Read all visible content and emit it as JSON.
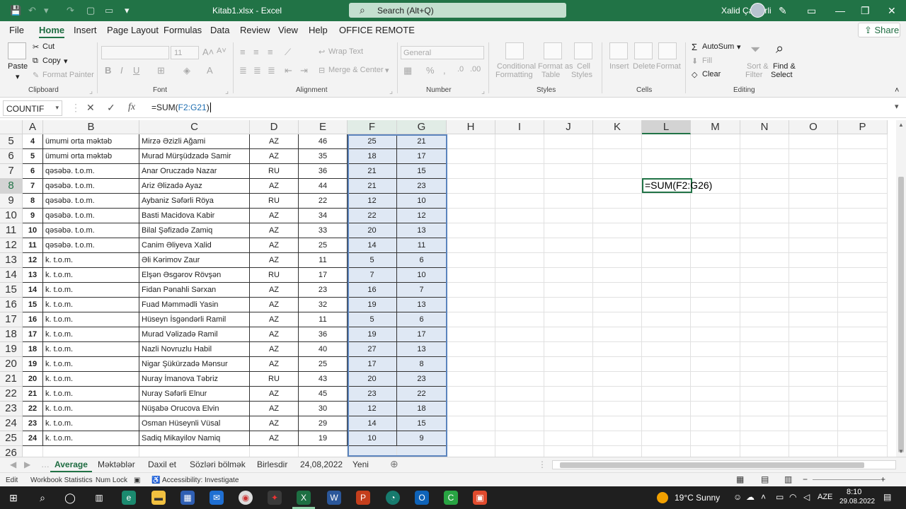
{
  "app": {
    "title": "Kitab1.xlsx  -  Excel",
    "search_label": "Search (Alt+Q)",
    "user_name": "Xalid Çandirli",
    "share_label": "Share"
  },
  "menu": {
    "tabs": [
      "File",
      "Home",
      "Insert",
      "Page Layout",
      "Formulas",
      "Data",
      "Review",
      "View",
      "Help",
      "OFFICE REMOTE"
    ],
    "active": "Home"
  },
  "ribbon": {
    "clipboard": {
      "paste": "Paste",
      "cut": "Cut",
      "copy": "Copy",
      "format_painter": "Format Painter",
      "group": "Clipboard"
    },
    "font": {
      "group": "Font",
      "size": "11"
    },
    "alignment": {
      "wrap_text": "Wrap Text",
      "merge_center": "Merge & Center",
      "group": "Alignment"
    },
    "number": {
      "format": "General",
      "group": "Number"
    },
    "styles": {
      "conditional": "Conditional",
      "conditional2": "Formatting",
      "format_as": "Format as",
      "format_as2": "Table",
      "cell": "Cell",
      "cell2": "Styles",
      "group": "Styles"
    },
    "cells": {
      "insert": "Insert",
      "delete": "Delete",
      "format": "Format",
      "group": "Cells"
    },
    "editing": {
      "autosum": "AutoSum",
      "fill": "Fill",
      "clear": "Clear",
      "sort": "Sort &",
      "sort2": "Filter",
      "find": "Find &",
      "find2": "Select",
      "group": "Editing"
    }
  },
  "formula_bar": {
    "name_box": "COUNTIF",
    "formula_prefix": "=SUM(",
    "formula_ref": "F2:G21",
    "formula_suffix": ")"
  },
  "columns": [
    "A",
    "B",
    "C",
    "D",
    "E",
    "F",
    "G",
    "H",
    "I",
    "J",
    "K",
    "L",
    "M",
    "N",
    "O",
    "P"
  ],
  "rows": [
    {
      "row": "5",
      "a": "4",
      "b": "ümumi orta məktəb",
      "c": "Mirzə Əzizli Ağami",
      "d": "AZ",
      "e": "46",
      "f": "25",
      "g": "21"
    },
    {
      "row": "6",
      "a": "5",
      "b": "ümumi orta məktəb",
      "c": "Murad Mürşüdzadə Samir",
      "d": "AZ",
      "e": "35",
      "f": "18",
      "g": "17"
    },
    {
      "row": "7",
      "a": "6",
      "b": "qəsəbə. t.o.m.",
      "c": "Anar Oruczadə Nazar",
      "d": "RU",
      "e": "36",
      "f": "21",
      "g": "15"
    },
    {
      "row": "8",
      "a": "7",
      "b": "qəsəbə. t.o.m.",
      "c": "Ariz Əlizadə Ayaz",
      "d": "AZ",
      "e": "44",
      "f": "21",
      "g": "23"
    },
    {
      "row": "9",
      "a": "8",
      "b": "qəsəbə. t.o.m.",
      "c": "Aybaniz Səfərli Röya",
      "d": "RU",
      "e": "22",
      "f": "12",
      "g": "10"
    },
    {
      "row": "10",
      "a": "9",
      "b": "qəsəbə. t.o.m.",
      "c": "Basti Macidova Kabir",
      "d": "AZ",
      "e": "34",
      "f": "22",
      "g": "12"
    },
    {
      "row": "11",
      "a": "10",
      "b": "qəsəbə. t.o.m.",
      "c": "Bilal Şəfizadə Zamiq",
      "d": "AZ",
      "e": "33",
      "f": "20",
      "g": "13"
    },
    {
      "row": "12",
      "a": "11",
      "b": "qəsəbə. t.o.m.",
      "c": "Canim Əliyeva Xalid",
      "d": "AZ",
      "e": "25",
      "f": "14",
      "g": "11"
    },
    {
      "row": "13",
      "a": "12",
      "b": "k. t.o.m.",
      "c": "Əli Kərimov Zaur",
      "d": "AZ",
      "e": "11",
      "f": "5",
      "g": "6"
    },
    {
      "row": "14",
      "a": "13",
      "b": "k. t.o.m.",
      "c": "Elşən Əsgərov Rövşən",
      "d": "RU",
      "e": "17",
      "f": "7",
      "g": "10"
    },
    {
      "row": "15",
      "a": "14",
      "b": "k. t.o.m.",
      "c": "Fidan Pənahli Sərxan",
      "d": "AZ",
      "e": "23",
      "f": "16",
      "g": "7"
    },
    {
      "row": "16",
      "a": "15",
      "b": "k. t.o.m.",
      "c": "Fuad Məmmədli Yasin",
      "d": "AZ",
      "e": "32",
      "f": "19",
      "g": "13"
    },
    {
      "row": "17",
      "a": "16",
      "b": "k. t.o.m.",
      "c": "Hüseyn İsgəndərli Ramil",
      "d": "AZ",
      "e": "11",
      "f": "5",
      "g": "6"
    },
    {
      "row": "18",
      "a": "17",
      "b": "k. t.o.m.",
      "c": "Murad Vəlizadə Ramil",
      "d": "AZ",
      "e": "36",
      "f": "19",
      "g": "17"
    },
    {
      "row": "19",
      "a": "18",
      "b": "k. t.o.m.",
      "c": "Nazli Novruzlu Habil",
      "d": "AZ",
      "e": "40",
      "f": "27",
      "g": "13"
    },
    {
      "row": "20",
      "a": "19",
      "b": "k. t.o.m.",
      "c": "Nigar Şükürzadə Mənsur",
      "d": "AZ",
      "e": "25",
      "f": "17",
      "g": "8"
    },
    {
      "row": "21",
      "a": "20",
      "b": "k. t.o.m.",
      "c": "Nuray İmanova Təbriz",
      "d": "RU",
      "e": "43",
      "f": "20",
      "g": "23"
    },
    {
      "row": "22",
      "a": "21",
      "b": "k. t.o.m.",
      "c": "Nuray Səfərli Elnur",
      "d": "AZ",
      "e": "45",
      "f": "23",
      "g": "22"
    },
    {
      "row": "23",
      "a": "22",
      "b": "k. t.o.m.",
      "c": "Nüşabə Orucova Elvin",
      "d": "AZ",
      "e": "30",
      "f": "12",
      "g": "18"
    },
    {
      "row": "24",
      "a": "23",
      "b": "k. t.o.m.",
      "c": "Osman Hüseynli Vüsal",
      "d": "AZ",
      "e": "29",
      "f": "14",
      "g": "15"
    },
    {
      "row": "25",
      "a": "24",
      "b": "k. t.o.m.",
      "c": "Sadiq Mikayilov Namiq",
      "d": "AZ",
      "e": "19",
      "f": "10",
      "g": "9"
    },
    {
      "row": "26",
      "a": "",
      "b": "",
      "c": "",
      "d": "",
      "e": "",
      "f": "",
      "g": ""
    }
  ],
  "active_cell": {
    "column": "L",
    "row": "8",
    "prefix": "=SUM(",
    "ref": "F2:G26",
    "suffix": ")"
  },
  "sheets": [
    "Average",
    "Məktəblər",
    "Daxil et",
    "Sözləri bölmək",
    "Birlesdir",
    "24,08,2022",
    "Yeni"
  ],
  "active_sheet": "Average",
  "status": {
    "mode": "Edit",
    "workbook_stats": "Workbook Statistics",
    "num_lock": "Num Lock",
    "accessibility": "Accessibility: Investigate"
  },
  "taskbar": {
    "weather": "19°C  Sunny",
    "language": "AZE",
    "time": "8:10",
    "date": "29.08.2022"
  },
  "colors": {
    "accent": "#217346",
    "selection": "#dfe8f4",
    "selection_border": "#5b84bd"
  }
}
